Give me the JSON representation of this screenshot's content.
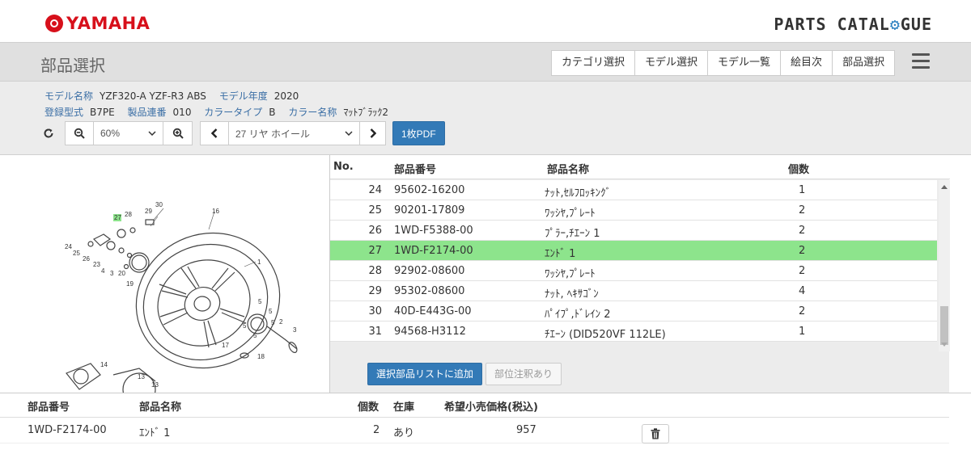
{
  "header": {
    "brand": "YAMAHA",
    "catalogue_title_pre": "PARTS CATAL",
    "catalogue_title_gear": "⚙",
    "catalogue_title_post": "GUE"
  },
  "page": {
    "title": "部品選択"
  },
  "nav": {
    "tabs": [
      "カテゴリ選択",
      "モデル選択",
      "モデル一覧",
      "絵目次",
      "部品選択"
    ]
  },
  "model": {
    "name_label": "モデル名称",
    "name_value": "YZF320-A YZF-R3 ABS",
    "year_label": "モデル年度",
    "year_value": "2020",
    "type_label": "登録型式",
    "type_value": "B7PE",
    "serial_label": "製品連番",
    "serial_value": "010",
    "color_type_label": "カラータイプ",
    "color_type_value": "B",
    "color_name_label": "カラー名称",
    "color_name_value": "ﾏｯﾄﾌﾞﾗｯｸ2"
  },
  "toolbar": {
    "zoom_value": "60%",
    "figure_value": "27 リヤ ホイール",
    "pdf_label": "1枚PDF"
  },
  "table": {
    "headers": {
      "no": "No.",
      "part_number": "部品番号",
      "part_name": "部品名称",
      "qty": "個数"
    },
    "rows": [
      {
        "no": "24",
        "part_number": "95602-16200",
        "part_name": "ﾅｯﾄ,ｾﾙﾌﾛｯｷﾝｸﾞ",
        "qty": "1",
        "selected": false
      },
      {
        "no": "25",
        "part_number": "90201-17809",
        "part_name": "ﾜｯｼﾔ,ﾌﾟﾚｰﾄ",
        "qty": "2",
        "selected": false
      },
      {
        "no": "26",
        "part_number": "1WD-F5388-00",
        "part_name": "ﾌﾟﾗｰ,ﾁｴｰﾝ 1",
        "qty": "2",
        "selected": false
      },
      {
        "no": "27",
        "part_number": "1WD-F2174-00",
        "part_name": "ｴﾝﾄﾞ 1",
        "qty": "2",
        "selected": true
      },
      {
        "no": "28",
        "part_number": "92902-08600",
        "part_name": "ﾜｯｼﾔ,ﾌﾟﾚｰﾄ",
        "qty": "2",
        "selected": false
      },
      {
        "no": "29",
        "part_number": "95302-08600",
        "part_name": "ﾅｯﾄ, ﾍｷｻｺﾞﾝ",
        "qty": "4",
        "selected": false
      },
      {
        "no": "30",
        "part_number": "40D-E443G-00",
        "part_name": "ﾊﾟｲﾌﾟ,ﾄﾞﾚｲﾝ 2",
        "qty": "2",
        "selected": false
      },
      {
        "no": "31",
        "part_number": "94568-H3112",
        "part_name": "ﾁｴｰﾝ (DID520VF 112LE)",
        "qty": "1",
        "selected": false
      }
    ],
    "add_button_label": "選択部品リストに追加",
    "note_button_label": "部位注釈あり",
    "selected_color": "#8de48c"
  },
  "selection": {
    "headers": {
      "part_number": "部品番号",
      "part_name": "部品名称",
      "qty": "個数",
      "stock": "在庫",
      "price": "希望小売価格(税込)"
    },
    "items": [
      {
        "part_number": "1WD-F2174-00",
        "part_name": "ｴﾝﾄﾞ 1",
        "qty": "2",
        "stock": "あり",
        "price": "957"
      }
    ]
  },
  "diagram": {
    "callouts": [
      "30",
      "29",
      "28",
      "27",
      "16",
      "24",
      "25",
      "26",
      "23",
      "4",
      "3",
      "20",
      "19",
      "1",
      "5",
      "5",
      "5",
      "5",
      "5",
      "2",
      "3",
      "17",
      "18",
      "14",
      "13",
      "13"
    ],
    "highlight": "27"
  },
  "colors": {
    "brand_red": "#d7101b",
    "primary_blue": "#337ab7",
    "label_blue": "#3a6ea5"
  }
}
